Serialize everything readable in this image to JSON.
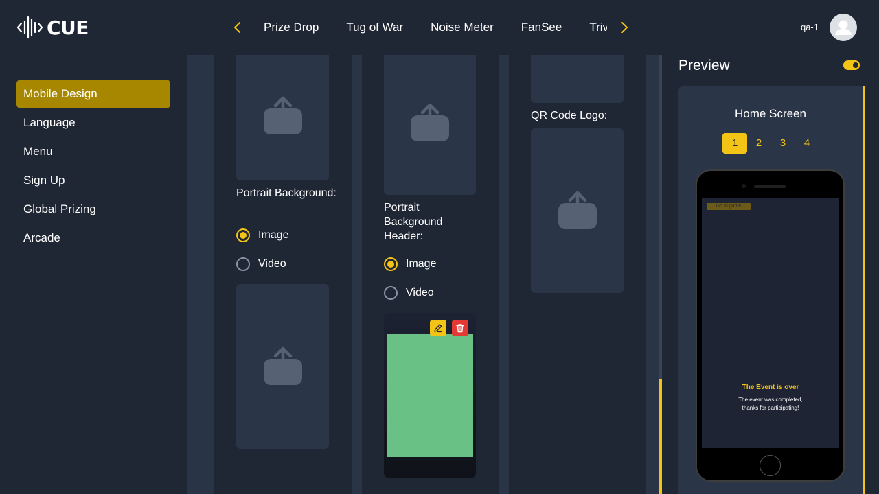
{
  "app": {
    "logo_text": "CUE"
  },
  "header": {
    "tabs": [
      {
        "label": "Prize Drop"
      },
      {
        "label": "Tug of War"
      },
      {
        "label": "Noise Meter"
      },
      {
        "label": "FanSee"
      },
      {
        "label": "Trivia"
      }
    ],
    "prev_icon": "chevron-left-icon",
    "next_icon": "chevron-right-icon",
    "user_name": "qa-1",
    "avatar_icon": "user-icon"
  },
  "sidebar": {
    "items": [
      {
        "label": "Mobile Design",
        "active": true
      },
      {
        "label": "Language"
      },
      {
        "label": "Menu"
      },
      {
        "label": "Sign Up"
      },
      {
        "label": "Global Prizing"
      },
      {
        "label": "Arcade"
      }
    ]
  },
  "columns": {
    "col1": {
      "portrait_label": "Portrait Background:",
      "options": [
        {
          "label": "Image",
          "checked": true
        },
        {
          "label": "Video",
          "checked": false
        }
      ]
    },
    "col2": {
      "portrait_label": "Portrait Background Header:",
      "options": [
        {
          "label": "Image",
          "checked": true
        },
        {
          "label": "Video",
          "checked": false
        }
      ],
      "uploaded_color": "#6ac186"
    },
    "col3": {
      "qr_label": "QR Code Logo:"
    }
  },
  "preview": {
    "title": "Preview",
    "toggle_on": true,
    "screen_title": "Home Screen",
    "pages": [
      "1",
      "2",
      "3",
      "4"
    ],
    "active_page": "1",
    "phone": {
      "go_button": "Go to game",
      "event_title": "The Event is over",
      "event_line1": "The event was completed,",
      "event_line2": "thanks for participating!"
    }
  },
  "colors": {
    "accent": "#f3c316",
    "active_sidebar": "#a88700",
    "background": "#1f2634",
    "delete": "#e53935"
  }
}
